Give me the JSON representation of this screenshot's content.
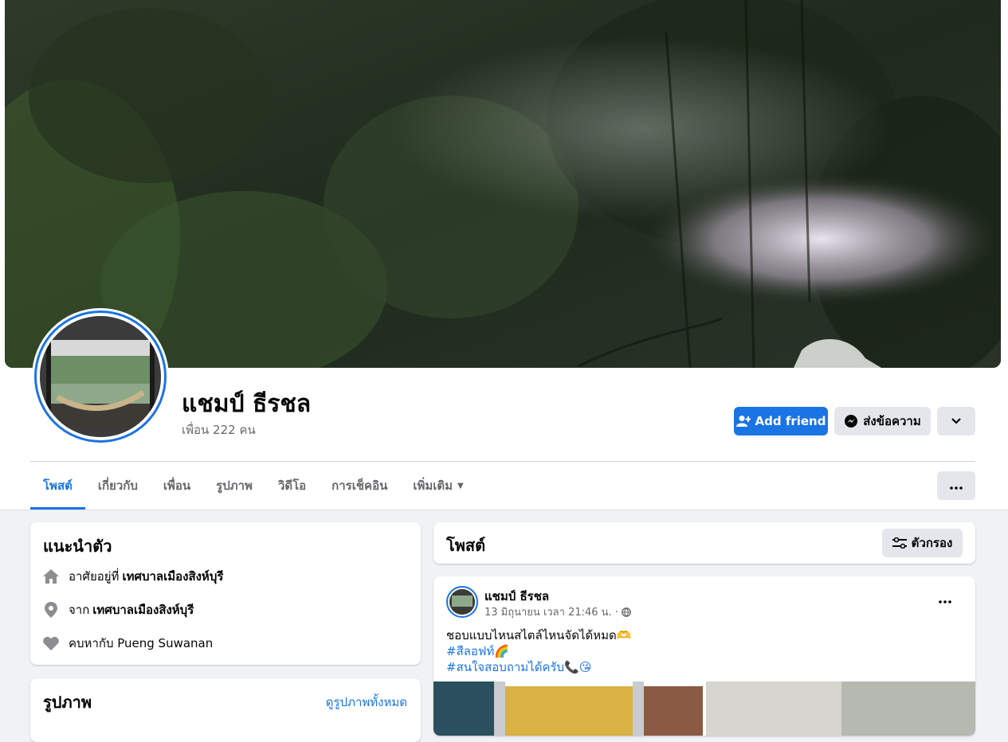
{
  "profile": {
    "name": "แชมป์ ธีรชล",
    "friends_count": "เพื่อน 222 คน"
  },
  "actions": {
    "add_friend": "Add friend",
    "message": "ส่งข้อความ"
  },
  "tabs": [
    {
      "label": "โพสต์",
      "active": true
    },
    {
      "label": "เกี่ยวกับ",
      "active": false
    },
    {
      "label": "เพื่อน",
      "active": false
    },
    {
      "label": "รูปภาพ",
      "active": false
    },
    {
      "label": "วิดีโอ",
      "active": false
    },
    {
      "label": "การเช็คอิน",
      "active": false
    },
    {
      "label": "เพิ่มเติม",
      "active": false
    }
  ],
  "intro": {
    "title": "แนะนำตัว",
    "lives_prefix": "อาศัยอยู่ที่",
    "lives_value": "เทศบาลเมืองสิงห์บุรี",
    "from_prefix": "จาก",
    "from_value": "เทศบาลเมืองสิงห์บุรี",
    "relationship": "คบหากับ Pueng Suwanan"
  },
  "photos": {
    "title": "รูปภาพ",
    "see_all": "ดูรูปภาพทั้งหมด"
  },
  "posts_header": {
    "title": "โพสต์",
    "filter": "ตัวกรอง"
  },
  "post": {
    "author": "แชมป์ ธีรชล",
    "timestamp": "13 มิถุนายน เวลา 21:46 น. ·",
    "line1": "ชอบแบบไหนสไตล์ไหนจัดได้หมด🫶",
    "line2": "#สีลอฟท์🌈",
    "line3": "#สนใจสอบถามได้ครับ📞😘"
  },
  "colors": {
    "accent": "#1b74e4",
    "page_bg": "#f0f2f5",
    "secondary_button": "#e4e6eb",
    "muted_text": "#65676b"
  },
  "icons": {
    "add_friend": "person-plus-icon",
    "message": "messenger-icon",
    "dropdown": "chevron-down-icon",
    "more": "more-dots-icon",
    "home": "home-icon",
    "location": "location-pin-icon",
    "heart": "heart-icon",
    "filter": "filter-icon",
    "audience": "globe-icon"
  }
}
